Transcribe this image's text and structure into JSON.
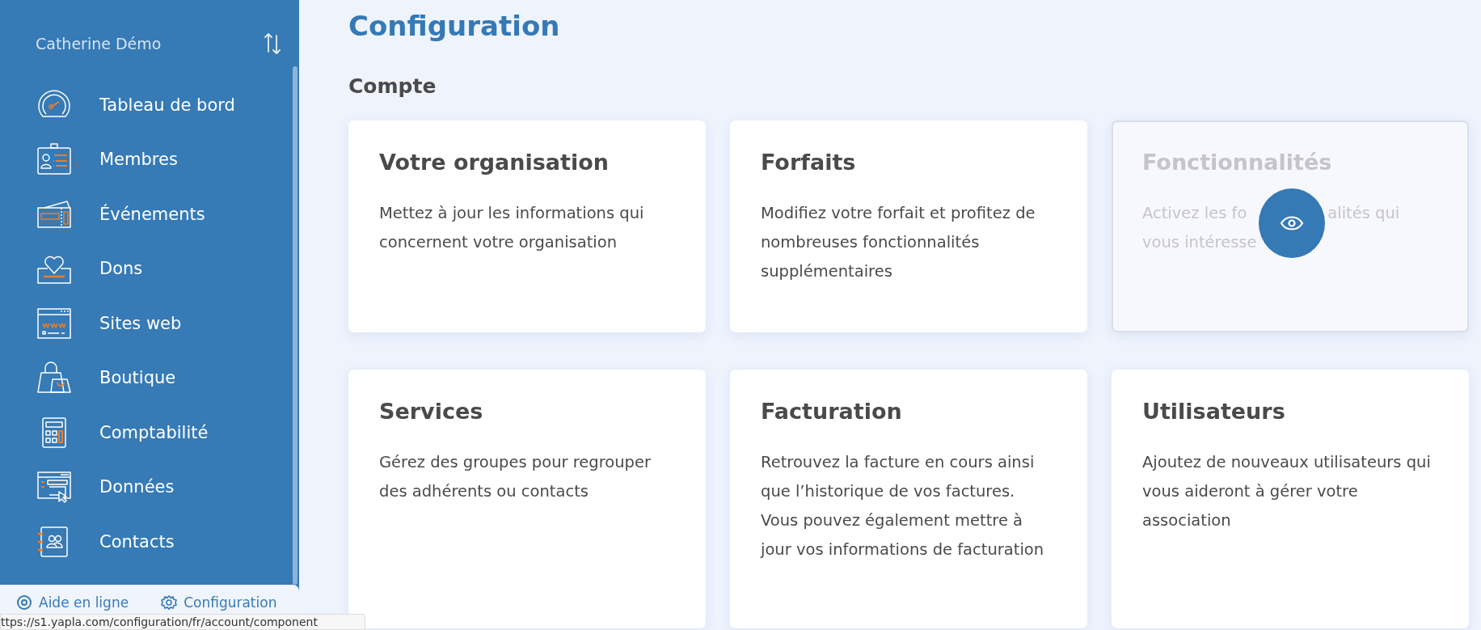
{
  "sidebar": {
    "user": "Catherine Démo",
    "items": [
      {
        "label": "Tableau de bord"
      },
      {
        "label": "Membres"
      },
      {
        "label": "Événements"
      },
      {
        "label": "Dons"
      },
      {
        "label": "Sites web"
      },
      {
        "label": "Boutique"
      },
      {
        "label": "Comptabilité"
      },
      {
        "label": "Données"
      },
      {
        "label": "Contacts"
      }
    ],
    "footer": [
      {
        "label": "Aide en ligne"
      },
      {
        "label": "Configuration"
      }
    ]
  },
  "page": {
    "title": "Configuration",
    "section": "Compte",
    "cards": [
      {
        "title": "Votre organisation",
        "description": "Mettez à jour les informations qui concernent votre organisation",
        "disabled": false
      },
      {
        "title": "Forfaits",
        "description": "Modifiez votre forfait et profitez de nombreuses fonctionnalités supplémentaires",
        "disabled": false
      },
      {
        "title": "Fonctionnalités",
        "description_lines": [
          [
            "Activez les fo",
            "alités qui"
          ],
          [
            "vous intéresse"
          ]
        ],
        "disabled": true
      },
      {
        "title": "Services",
        "description": "Gérez des groupes pour regrouper des adhérents ou contacts",
        "disabled": false
      },
      {
        "title": "Facturation",
        "description": "Retrouvez la facture en cours ainsi que l’historique de vos factures. Vous pouvez également mettre à jour vos informations de facturation",
        "disabled": false
      },
      {
        "title": "Utilisateurs",
        "description": "Ajoutez de nouveaux utilisateurs qui vous aideront à gérer votre association",
        "disabled": false
      }
    ]
  },
  "status_bar": {
    "url": "ttps://s1.yapla.com/configuration/fr/account/component"
  }
}
